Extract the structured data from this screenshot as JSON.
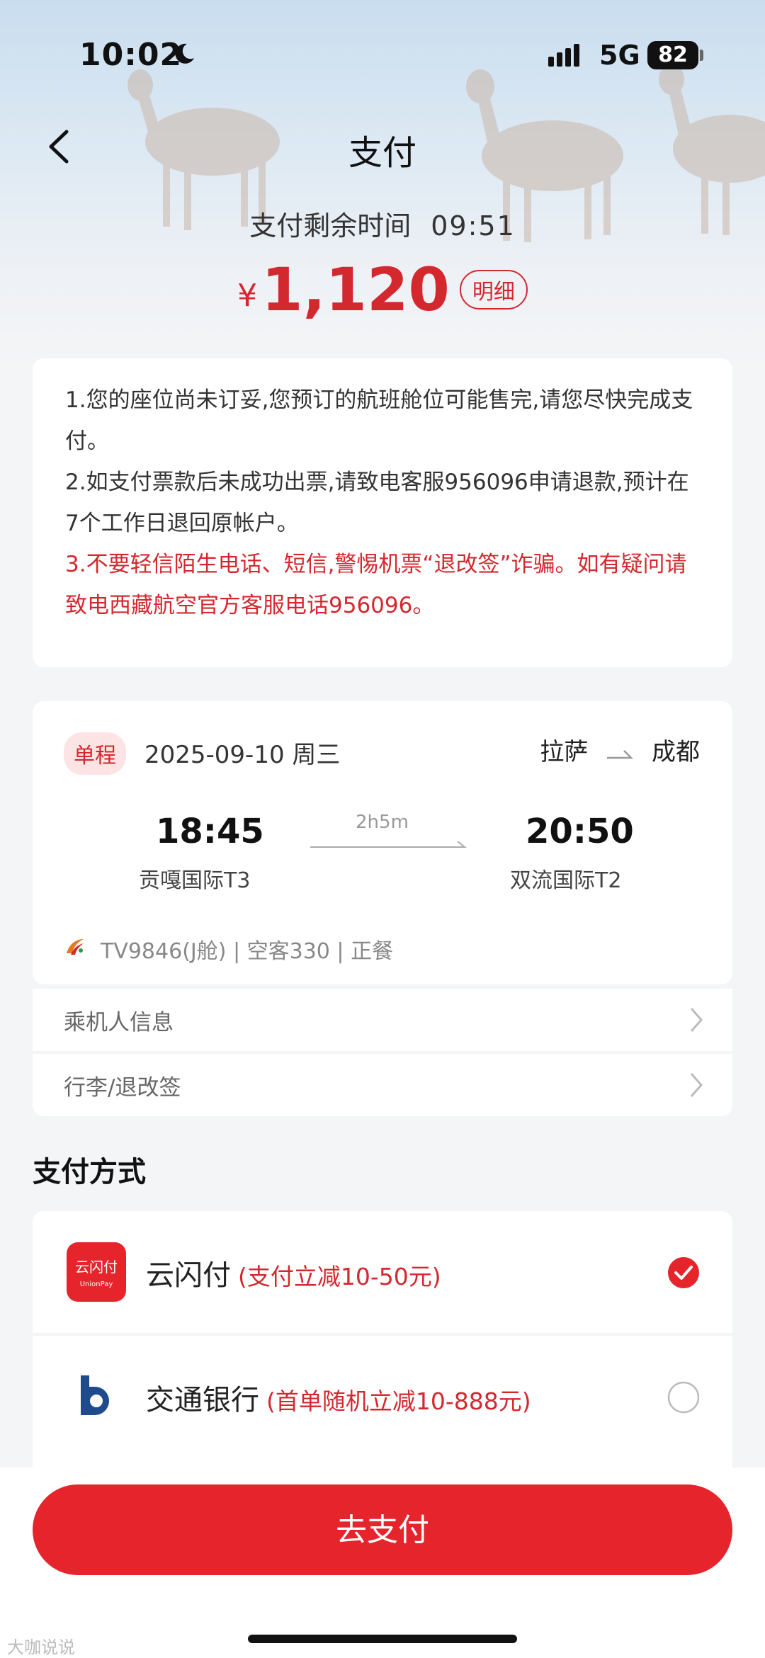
{
  "status_bar": {
    "time": "10:02",
    "network": "5G",
    "battery": "82"
  },
  "header": {
    "title": "支付"
  },
  "payment": {
    "countdown_label": "支付剩余时间",
    "countdown_value": "09:51",
    "currency": "¥",
    "amount": "1,120",
    "detail_label": "明细"
  },
  "notices": [
    "1.您的座位尚未订妥,您预订的航班舱位可能售完,请您尽快完成支付。",
    "2.如支付票款后未成功出票,请致电客服956096申请退款,预计在7个工作日退回原帐户。",
    "3.不要轻信陌生电话、短信,警惕机票“退改签”诈骗。如有疑问请致电西藏航空官方客服电话956096。"
  ],
  "flight": {
    "trip_type": "单程",
    "date": "2025-09-10 周三",
    "from_city": "拉萨",
    "to_city": "成都",
    "dep_time": "18:45",
    "arr_time": "20:50",
    "duration": "2h5m",
    "dep_airport": "贡嘎国际T3",
    "arr_airport": "双流国际T2",
    "info": "TV9846(J舱) | 空客330 | 正餐"
  },
  "rows": {
    "passenger": "乘机人信息",
    "baggage": "行李/退改签"
  },
  "payment_methods": {
    "heading": "支付方式",
    "items": [
      {
        "name": "云闪付",
        "promo": "(支付立减10-50元)",
        "selected": true,
        "logo_text": "云闪付",
        "logo_sub": "UnionPay"
      },
      {
        "name": "交通银行",
        "promo": "(首单随机立减10-888元)",
        "selected": false
      }
    ]
  },
  "actions": {
    "pay_label": "去支付"
  },
  "watermark": "大咖说说",
  "colors": {
    "accent": "#e5242c",
    "text_red": "#d4282f"
  }
}
